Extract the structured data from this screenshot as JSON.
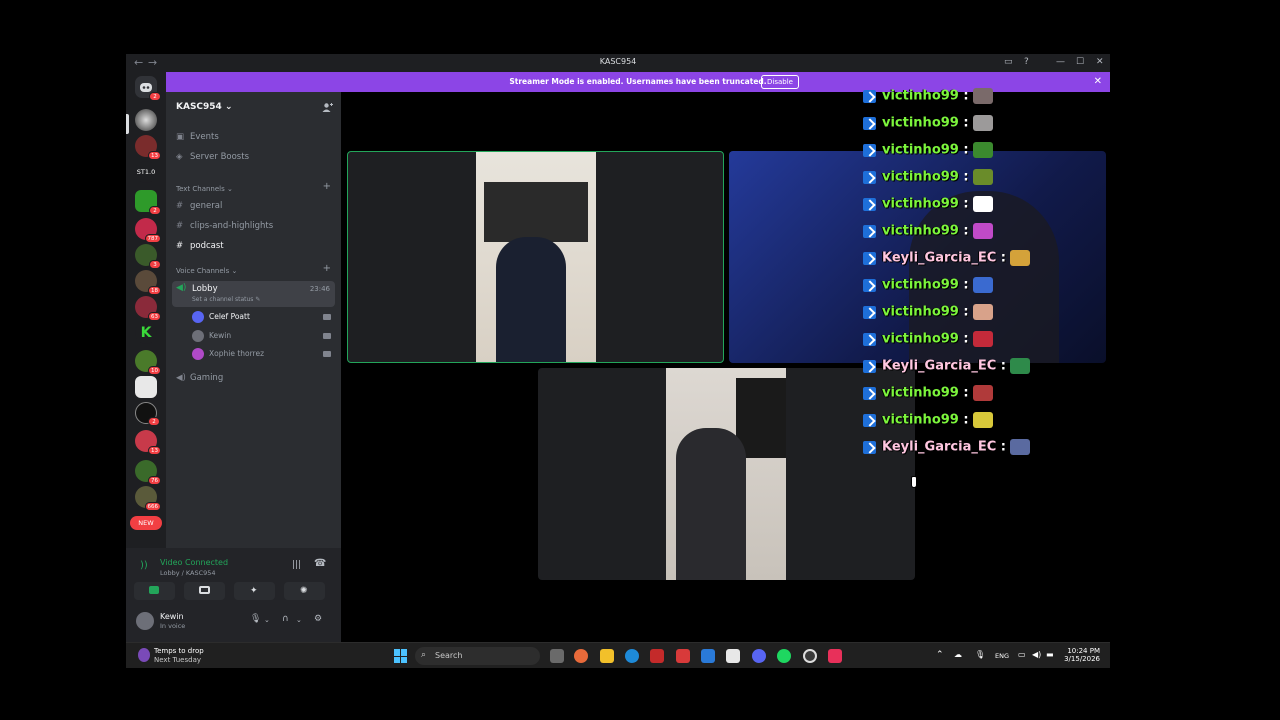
{
  "window": {
    "title": "KASC954",
    "nav_back": "←",
    "nav_fwd": "→",
    "controls": [
      "▭",
      "?",
      "—",
      "☐",
      "✕"
    ]
  },
  "banner": {
    "message": "Streamer Mode is enabled. Usernames have been truncated.",
    "button": "Disable",
    "close": "✕"
  },
  "rail": {
    "label_st": "ST1.0",
    "new_badge": "NEW",
    "badges": [
      "2",
      "13",
      "2",
      "787",
      "3",
      "18",
      "63",
      "10",
      "2",
      "13",
      "76",
      "666"
    ]
  },
  "sidebar": {
    "server_name": "KASC954 ⌄",
    "events": "Events",
    "boosts": "Server Boosts",
    "text_category": "Text Channels ⌄",
    "text_channels": [
      "general",
      "clips-and-highlights",
      "podcast"
    ],
    "voice_category": "Voice Channels ⌄",
    "lobby": {
      "name": "Lobby",
      "timer": "23:46",
      "status": "Set a channel status ✎",
      "users": [
        "Celef Poatt",
        "Kewin",
        "Xophie thorrez"
      ]
    },
    "gaming": "Gaming"
  },
  "voice_panel": {
    "status": "Video Connected",
    "location": "Lobby / KASC954",
    "username": "Kewin",
    "user_status": "In voice"
  },
  "chat": [
    {
      "user": "victinho99",
      "color": "green",
      "emote": "#7a6a6a"
    },
    {
      "user": "victinho99",
      "color": "green",
      "emote": "#9c9a9a"
    },
    {
      "user": "victinho99",
      "color": "green",
      "emote": "#3b8a2e"
    },
    {
      "user": "victinho99",
      "color": "green",
      "emote": "#6a8c2a"
    },
    {
      "user": "victinho99",
      "color": "green",
      "emote": "#ffffff"
    },
    {
      "user": "victinho99",
      "color": "green",
      "emote": "#c04ac8"
    },
    {
      "user": "Keyli_Garcia_EC",
      "color": "pink",
      "emote": "#d4a23a"
    },
    {
      "user": "victinho99",
      "color": "green",
      "emote": "#3a6ad0"
    },
    {
      "user": "victinho99",
      "color": "green",
      "emote": "#d8a28a"
    },
    {
      "user": "victinho99",
      "color": "green",
      "emote": "#c42a3a"
    },
    {
      "user": "Keyli_Garcia_EC",
      "color": "pink",
      "emote": "#2e8a4a"
    },
    {
      "user": "victinho99",
      "color": "green",
      "emote": "#b03a3a"
    },
    {
      "user": "victinho99",
      "color": "green",
      "emote": "#d8c83a"
    },
    {
      "user": "Keyli_Garcia_EC",
      "color": "pink",
      "emote": "#5a6aa0"
    }
  ],
  "chat_sep": ":",
  "taskbar": {
    "weather_title": "Temps to drop",
    "weather_sub": "Next Tuesday",
    "search": "Search",
    "lang": "ENG",
    "time": "10:24 PM",
    "date": "3/15/2026"
  }
}
